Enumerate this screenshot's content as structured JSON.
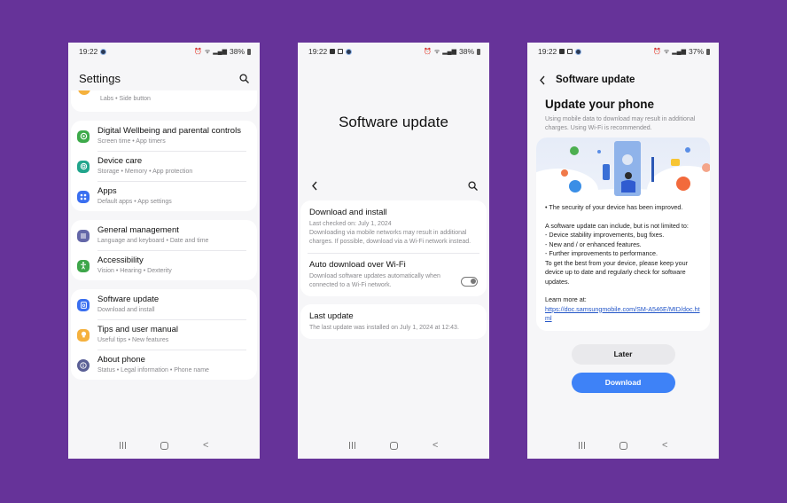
{
  "background_color": "#663399",
  "screens": [
    {
      "status": {
        "time": "19:22",
        "battery": "38%"
      },
      "title": "Settings",
      "partial_item": {
        "subtitle": "Labs  •  Side button",
        "icon_color": "#f5b13d"
      },
      "groups": [
        [
          {
            "title": "Digital Wellbeing and parental controls",
            "subtitle": "Screen time  •  App timers",
            "icon": "wellbeing-icon",
            "icon_color": "#3daa4a"
          },
          {
            "title": "Device care",
            "subtitle": "Storage  •  Memory  •  App protection",
            "icon": "device-care-icon",
            "icon_color": "#21a58c"
          },
          {
            "title": "Apps",
            "subtitle": "Default apps  •  App settings",
            "icon": "apps-icon",
            "icon_color": "#3a6ff0"
          }
        ],
        [
          {
            "title": "General management",
            "subtitle": "Language and keyboard  •  Date and time",
            "icon": "general-management-icon",
            "icon_color": "#6467a8"
          },
          {
            "title": "Accessibility",
            "subtitle": "Vision  •  Hearing  •  Dexterity",
            "icon": "accessibility-icon",
            "icon_color": "#3ea64a"
          }
        ],
        [
          {
            "title": "Software update",
            "subtitle": "Download and install",
            "icon": "software-update-icon",
            "icon_color": "#3a6ff0"
          },
          {
            "title": "Tips and user manual",
            "subtitle": "Useful tips  •  New features",
            "icon": "tips-icon",
            "icon_color": "#f5b13d"
          },
          {
            "title": "About phone",
            "subtitle": "Status  •  Legal information  •  Phone name",
            "icon": "about-phone-icon",
            "icon_color": "#5a5f95"
          }
        ]
      ]
    },
    {
      "status": {
        "time": "19:22",
        "battery": "38%"
      },
      "title": "Software update",
      "items": [
        {
          "title": "Download and install",
          "subtitle": "Last checked on: July 1, 2024",
          "description": "Downloading via mobile networks may result in additional charges. If possible, download via a Wi-Fi network instead."
        },
        {
          "title": "Auto download over Wi-Fi",
          "description": "Download software updates automatically when connected to a Wi-Fi network.",
          "toggle_on": false
        }
      ],
      "last_update": {
        "title": "Last update",
        "description": "The last update was installed on July 1, 2024 at 12:43."
      }
    },
    {
      "status": {
        "time": "19:22",
        "battery": "37%"
      },
      "header_title": "Software update",
      "heading": "Update your phone",
      "note": "Using mobile data to download may result in additional charges. Using Wi-Fi is recommended.",
      "body": {
        "security": "• The security of your device has been improved.",
        "intro": "A software update can include, but is not limited to:",
        "bullets": [
          " - Device stability improvements, bug fixes.",
          " - New and / or enhanced features.",
          " - Further improvements to performance."
        ],
        "advice": "To get the best from your device, please keep your device up to date and regularly check for software updates.",
        "learn_more": "Learn more at:",
        "link": "https://doc.samsungmobile.com/SM-A546E/MID/doc.html"
      },
      "buttons": {
        "later": "Later",
        "download": "Download"
      },
      "accent_color": "#3e82f7"
    }
  ]
}
